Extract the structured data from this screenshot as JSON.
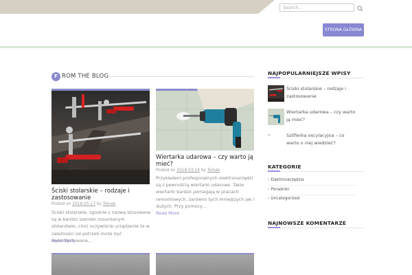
{
  "header": {
    "search_placeholder": "Search...",
    "nav_button": "STRONA GŁÓWNA"
  },
  "blog": {
    "badge_letter": "F",
    "heading": "ROM THE BLOG"
  },
  "posts": [
    {
      "title": "Ściski stolarskie – rodzaje i zastosowanie",
      "posted_on": "Posted on",
      "date": "2018-05-17",
      "by": "by",
      "author": "Tomek",
      "excerpt": "Ściski stolarskie, zgodnie z nazwą stosowane są w bardzo szeroko rozumianym stolarstwie, choć oczywiście urządzenie to w zależności od potrzeb może być wykorzystywane…",
      "read_more": "Read More"
    },
    {
      "title": "Wiertarka udarowa – czy warto ją mieć?",
      "posted_on": "Posted on",
      "date": "2018-03-14",
      "by": "by",
      "author": "Tomek",
      "excerpt": "Przykładem profesjonalnych elektronarzędzi są z pewnością wiertarki udarowe. Takie wiertarki bardzo pomagają w pracach remontowych, zarówno tych mniejszych jak i dużych. Przy pomocy…",
      "read_more": "Read More"
    }
  ],
  "sidebar": {
    "popular_title": "NAJPOPULARNIEJSZE WPISY",
    "popular": [
      "Ściski stolarskie – rodzaje i zastosowanie",
      "Wiertarka udarowa – czy warto ją mieć?",
      "Szlifierka oscylacyjna – co warto o niej wiedzieć?"
    ],
    "categories_title": "KATEGORIE",
    "categories": [
      "Elektronarzędzia",
      "Poradniki",
      "Uncategorized"
    ],
    "comments_title": "NAJNOWSZE KOMENTARZE"
  }
}
